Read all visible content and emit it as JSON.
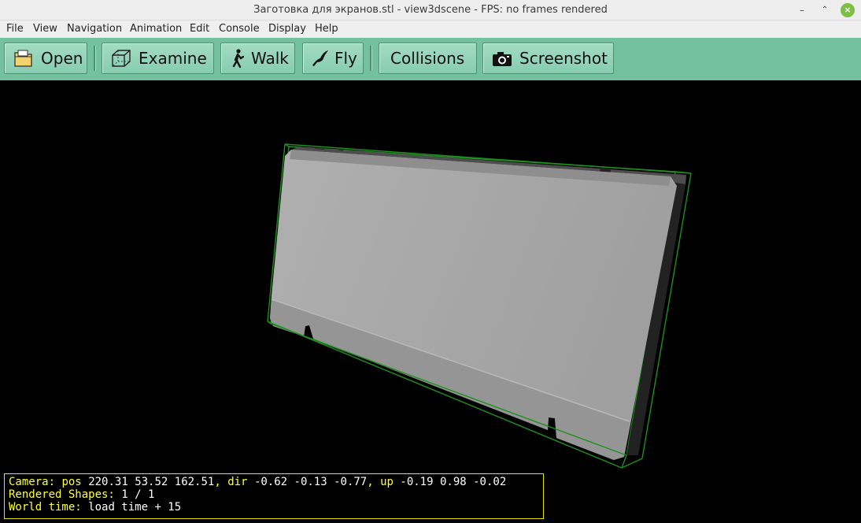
{
  "window": {
    "title": "Заготовка для экранов.stl - view3dscene - FPS: no frames rendered",
    "min_glyph": "–",
    "max_glyph": "⌃",
    "close_glyph": "×"
  },
  "menu": [
    "File",
    "View",
    "Navigation",
    "Animation",
    "Edit",
    "Console",
    "Display",
    "Help"
  ],
  "toolbar": {
    "open": "Open",
    "examine": "Examine",
    "walk": "Walk",
    "fly": "Fly",
    "collisions": "Collisions",
    "screenshot": "Screenshot"
  },
  "hud": {
    "camera_label": "Camera:",
    "pos_label": "pos",
    "pos_value": "220.31 53.52 162.51",
    "dir_label": "dir",
    "dir_value": "-0.62 -0.13 -0.77",
    "up_label": "up",
    "up_value": "-0.19 0.98 -0.02",
    "shapes_label": "Rendered Shapes:",
    "shapes_value": "1 / 1",
    "time_label": "World time:",
    "time_value": "load time + 15"
  },
  "colors": {
    "toolbar_bg": "#73c19e",
    "bbox": "#1f8f1f",
    "model": "#a6a6a6",
    "hud_label": "#ffff33",
    "hud_border": "#e7e700"
  }
}
